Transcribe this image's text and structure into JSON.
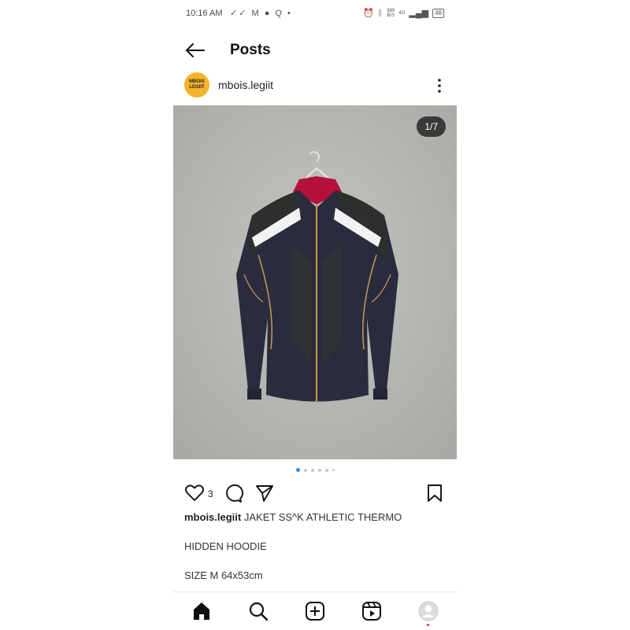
{
  "status_bar": {
    "time": "10:16 AM",
    "left_icons": "✓✓ M ● Q •",
    "net_speed_value": "889",
    "net_speed_unit": "B/S",
    "signal": "4G",
    "battery": "48"
  },
  "header": {
    "title": "Posts"
  },
  "post": {
    "avatar_text_line1": "MBOIS",
    "avatar_text_line2": "LEGIIT",
    "username": "mbois.legiit",
    "image_counter": "1/7",
    "carousel_total": 7,
    "carousel_active_index": 0,
    "likes_count": "3",
    "caption_user": "mbois.legiit",
    "caption_line1": "JAKET SS^K ATHLETIC THERMO",
    "caption_line2": "HIDDEN HOODIE",
    "caption_line3": "SIZE M 64x53cm"
  },
  "colors": {
    "accent_blue": "#2d8fe3",
    "avatar_bg": "#f4b52b",
    "notification": "#e0245e"
  },
  "icons": [
    "back-arrow-icon",
    "more-vertical-icon",
    "heart-icon",
    "comment-icon",
    "share-icon",
    "bookmark-icon",
    "home-icon",
    "search-icon",
    "create-icon",
    "reels-icon",
    "profile-icon"
  ]
}
